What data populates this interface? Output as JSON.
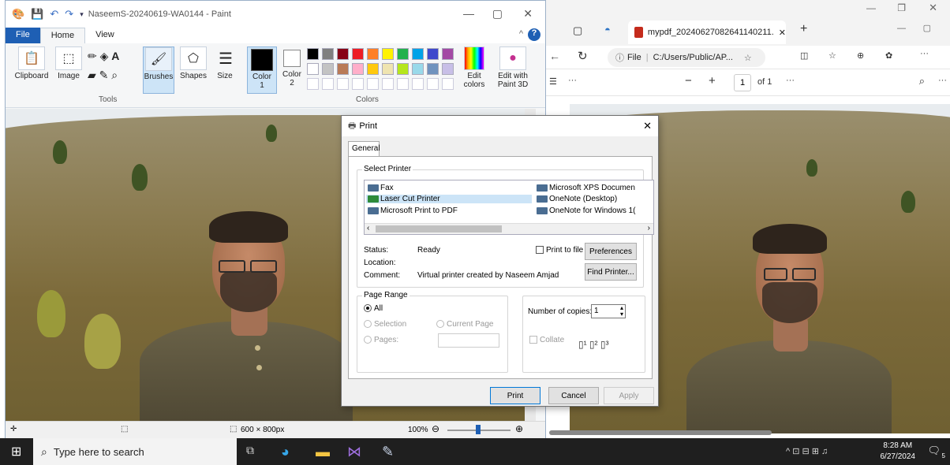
{
  "paint": {
    "title": "NaseemS-20240619-WA0144 - Paint",
    "tabs": [
      "File",
      "Home",
      "View"
    ],
    "ribbon": {
      "clipboard": "Clipboard",
      "image": "Image",
      "brushes": "Brushes",
      "shapes": "Shapes",
      "size": "Size",
      "color1": "Color",
      "color1_num": "1",
      "color2": "Color",
      "color2_num": "2",
      "edit_colors": "Edit colors",
      "edit_paint3d": "Edit with Paint 3D",
      "tools_group": "Tools",
      "colors_group": "Colors"
    },
    "palette_row1": [
      "#000000",
      "#7f7f7f",
      "#880015",
      "#ed1c24",
      "#ff7f27",
      "#fff200",
      "#22b14c",
      "#00a2e8",
      "#3f48cc",
      "#a349a4"
    ],
    "palette_row2": [
      "#ffffff",
      "#c3c3c3",
      "#b97a57",
      "#ffaec9",
      "#ffc90e",
      "#efe4b0",
      "#b5e61d",
      "#99d9ea",
      "#7092be",
      "#c8bfe7"
    ],
    "status": {
      "dimensions": "600 × 800px",
      "zoom": "100%"
    }
  },
  "edge": {
    "tab_title": "mypdf_20240627082641140211.",
    "url_prefix": "File",
    "url": "C:/Users/Public/AP...",
    "page_num": "1",
    "page_of": "of 1"
  },
  "print_dialog": {
    "title": "Print",
    "tab": "General",
    "select_printer_label": "Select Printer",
    "printers_left": [
      "Fax",
      "Laser Cut Printer",
      "Microsoft Print to PDF"
    ],
    "printers_right": [
      "Microsoft XPS Documen",
      "OneNote (Desktop)",
      "OneNote for Windows 1("
    ],
    "status_label": "Status:",
    "status_value": "Ready",
    "location_label": "Location:",
    "comment_label": "Comment:",
    "comment_value": "Virtual printer created by Naseem Amjad",
    "print_to_file": "Print to file",
    "preferences": "Preferences",
    "find_printer": "Find Printer...",
    "page_range_label": "Page Range",
    "range_all": "All",
    "range_selection": "Selection",
    "range_current": "Current Page",
    "range_pages": "Pages:",
    "copies_label": "Number of copies:",
    "copies_value": "1",
    "collate": "Collate",
    "btn_print": "Print",
    "btn_cancel": "Cancel",
    "btn_apply": "Apply"
  },
  "taskbar": {
    "search_placeholder": "Type here to search",
    "time": "8:28 AM",
    "date": "6/27/2024",
    "notification_count": "5"
  }
}
